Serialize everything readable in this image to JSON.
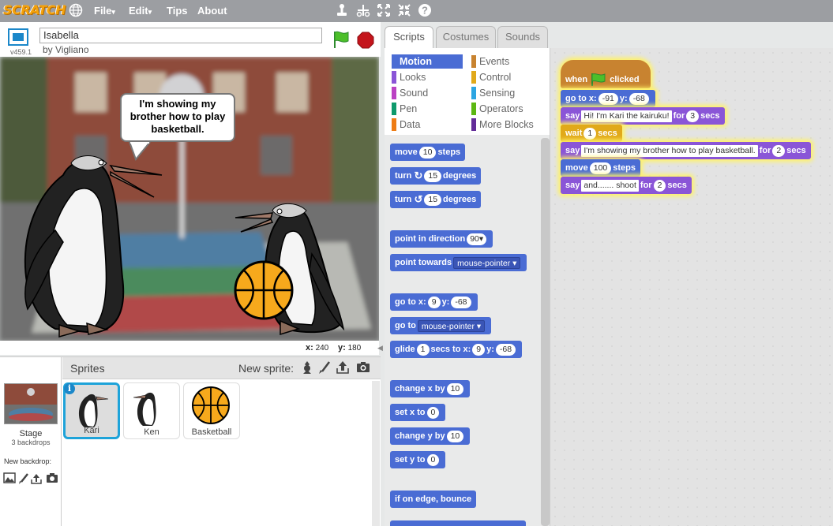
{
  "app": {
    "logo": "SCRATCH",
    "menus": [
      {
        "label": "File",
        "caret": "▾"
      },
      {
        "label": "Edit",
        "caret": "▾"
      },
      {
        "label": "Tips"
      },
      {
        "label": "About"
      }
    ]
  },
  "project": {
    "title": "Isabella",
    "author": "by Vigliano",
    "version": "v459.1"
  },
  "stage": {
    "speech_lines": [
      "I'm showing my",
      "brother how to play",
      "basketball."
    ],
    "x_label": "x:",
    "x_value": "240",
    "y_label": "y:",
    "y_value": "180"
  },
  "sprites_pane": {
    "title": "Sprites",
    "new_sprite_label": "New sprite:",
    "stage_label": "Stage",
    "backdrop_count": "3 backdrops",
    "new_backdrop_label": "New backdrop:",
    "sprites": [
      {
        "name": "Kari",
        "selected": true
      },
      {
        "name": "Ken",
        "selected": false
      },
      {
        "name": "Basketball",
        "selected": false
      }
    ],
    "info_badge": "i"
  },
  "tabs": [
    "Scripts",
    "Costumes",
    "Sounds"
  ],
  "categories": [
    {
      "label": "Motion",
      "color": "#4a6cd4"
    },
    {
      "label": "Events",
      "color": "#c88330"
    },
    {
      "label": "Looks",
      "color": "#8a55d7"
    },
    {
      "label": "Control",
      "color": "#e1a91a"
    },
    {
      "label": "Sound",
      "color": "#bb42c3"
    },
    {
      "label": "Sensing",
      "color": "#2ca5e2"
    },
    {
      "label": "Pen",
      "color": "#0e9a6c"
    },
    {
      "label": "Operators",
      "color": "#5cb712"
    },
    {
      "label": "Data",
      "color": "#ee7d16"
    },
    {
      "label": "More Blocks",
      "color": "#632d99"
    }
  ],
  "palette": {
    "move": {
      "a": "move",
      "n": "10",
      "b": "steps"
    },
    "turn_cw": {
      "a": "turn",
      "n": "15",
      "b": "degrees"
    },
    "turn_ccw": {
      "a": "turn",
      "n": "15",
      "b": "degrees"
    },
    "point_dir": {
      "a": "point in direction",
      "n": "90▾"
    },
    "point_towards": {
      "a": "point towards",
      "d": "mouse-pointer ▾"
    },
    "goto_xy": {
      "a": "go to x:",
      "x": "9",
      "b": "y:",
      "y": "-68"
    },
    "goto": {
      "a": "go to",
      "d": "mouse-pointer ▾"
    },
    "glide": {
      "a": "glide",
      "n": "1",
      "b": "secs to x:",
      "x": "9",
      "c": "y:",
      "y": "-68"
    },
    "change_x": {
      "a": "change x by",
      "n": "10"
    },
    "set_x": {
      "a": "set x to",
      "n": "0"
    },
    "change_y": {
      "a": "change y by",
      "n": "10"
    },
    "set_y": {
      "a": "set y to",
      "n": "0"
    },
    "bounce": {
      "a": "if on edge, bounce"
    }
  },
  "script": {
    "hat": {
      "a": "when",
      "b": "clicked"
    },
    "goto": {
      "a": "go to x:",
      "x": "-91",
      "b": "y:",
      "y": "-68"
    },
    "say1": {
      "a": "say",
      "t": "Hi! I'm Kari the kairuku!",
      "b": "for",
      "n": "3",
      "c": "secs"
    },
    "wait": {
      "a": "wait",
      "n": "1",
      "b": "secs"
    },
    "say2": {
      "a": "say",
      "t": "I'm showing my  brother how to play basketball.",
      "b": "for",
      "n": "2",
      "c": "secs"
    },
    "move": {
      "a": "move",
      "n": "100",
      "b": "steps"
    },
    "say3": {
      "a": "say",
      "t": "and....... shoot",
      "b": "for",
      "n": "2",
      "c": "secs"
    }
  }
}
